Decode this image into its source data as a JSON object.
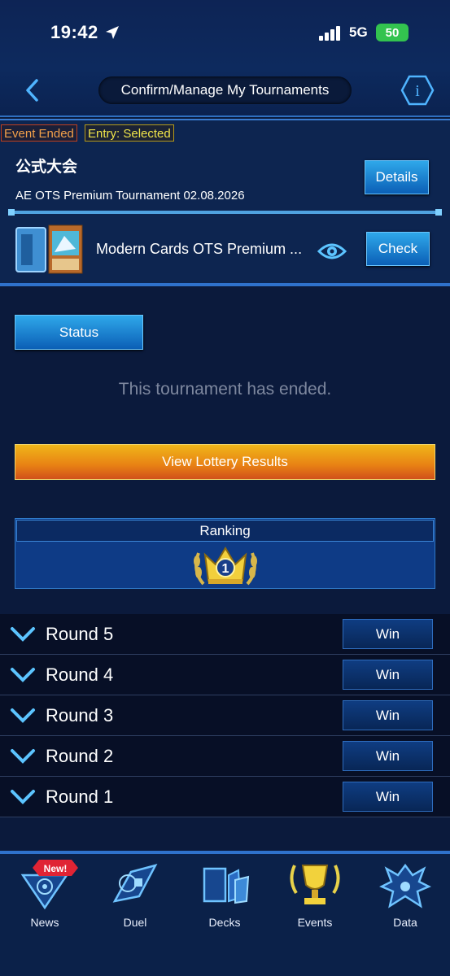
{
  "status_bar": {
    "time": "19:42",
    "network": "5G",
    "battery": "50"
  },
  "header": {
    "title": "Confirm/Manage My Tournaments"
  },
  "tournament": {
    "tag_ended": "Event Ended",
    "tag_entry": "Entry: Selected",
    "name": "公式大会",
    "description": "AE OTS Premium  Tournament  02.08.2026",
    "details_label": "Details",
    "deck_name": "Modern Cards OTS Premium ...",
    "check_label": "Check"
  },
  "status": {
    "button_label": "Status",
    "message": "This tournament has ended.",
    "lottery_label": "View Lottery Results"
  },
  "ranking": {
    "title": "Ranking",
    "rank": "1"
  },
  "rounds": [
    {
      "label": "Round 5",
      "result": "Win"
    },
    {
      "label": "Round 4",
      "result": "Win"
    },
    {
      "label": "Round 3",
      "result": "Win"
    },
    {
      "label": "Round 2",
      "result": "Win"
    },
    {
      "label": "Round 1",
      "result": "Win"
    }
  ],
  "nav": {
    "badge": "New!",
    "items": [
      {
        "label": "News",
        "icon": "news-icon"
      },
      {
        "label": "Duel",
        "icon": "duel-icon"
      },
      {
        "label": "Decks",
        "icon": "decks-icon"
      },
      {
        "label": "Events",
        "icon": "events-icon"
      },
      {
        "label": "Data",
        "icon": "data-icon"
      }
    ]
  },
  "colors": {
    "accent": "#2f72cc",
    "lottery": "#e88114",
    "background": "#0b1a3c"
  }
}
